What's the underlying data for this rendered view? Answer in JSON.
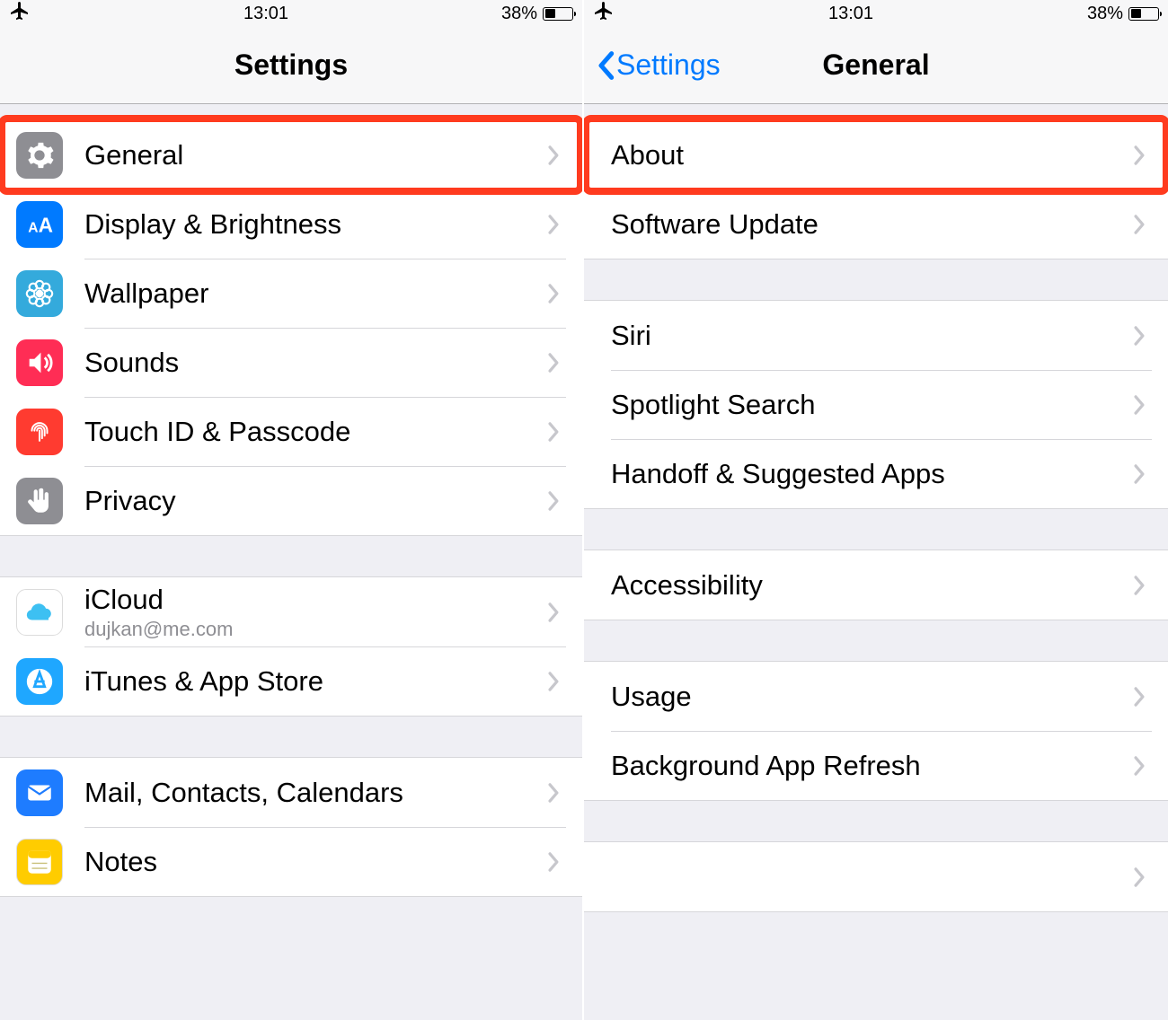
{
  "status": {
    "time": "13:01",
    "battery_pct": "38%",
    "battery_fill_pct": 38
  },
  "left": {
    "title": "Settings",
    "highlight_index": 0,
    "groups": [
      [
        {
          "icon": "gear",
          "color": "#8e8e93",
          "label": "General"
        },
        {
          "icon": "textsize",
          "color": "#007aff",
          "label": "Display & Brightness"
        },
        {
          "icon": "flower",
          "color": "#34aadc",
          "label": "Wallpaper"
        },
        {
          "icon": "speaker",
          "color": "#ff2d55",
          "label": "Sounds"
        },
        {
          "icon": "fingerprint",
          "color": "#ff3b30",
          "label": "Touch ID & Passcode"
        },
        {
          "icon": "hand",
          "color": "#8e8e93",
          "label": "Privacy"
        }
      ],
      [
        {
          "icon": "cloud",
          "color": "#ffffff",
          "label": "iCloud",
          "sublabel": "dujkan@me.com"
        },
        {
          "icon": "appstore",
          "color": "#1fa7ff",
          "label": "iTunes & App Store"
        }
      ],
      [
        {
          "icon": "mail",
          "color": "#1e7cff",
          "label": "Mail, Contacts, Calendars"
        },
        {
          "icon": "notes",
          "color": "#ffcc00",
          "label": "Notes"
        }
      ]
    ]
  },
  "right": {
    "title": "General",
    "back_label": "Settings",
    "highlight_index": 0,
    "groups": [
      [
        {
          "label": "About"
        },
        {
          "label": "Software Update"
        }
      ],
      [
        {
          "label": "Siri"
        },
        {
          "label": "Spotlight Search"
        },
        {
          "label": "Handoff & Suggested Apps"
        }
      ],
      [
        {
          "label": "Accessibility"
        }
      ],
      [
        {
          "label": "Usage"
        },
        {
          "label": "Background App Refresh"
        }
      ],
      [
        {
          "label": ""
        }
      ]
    ]
  }
}
